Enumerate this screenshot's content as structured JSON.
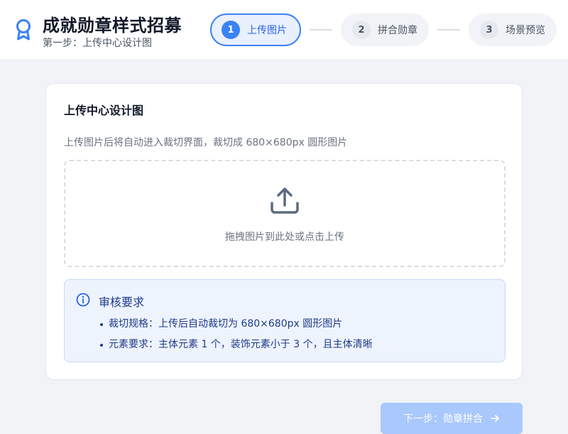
{
  "header": {
    "title": "成就勋章样式招募",
    "subtitle": "第一步：上传中心设计图",
    "brand_icon": "award-ribbon-icon",
    "accent_color": "#3b82f6"
  },
  "steps": [
    {
      "number": "1",
      "label": "上传图片",
      "active": true
    },
    {
      "number": "2",
      "label": "拼合勋章",
      "active": false
    },
    {
      "number": "3",
      "label": "场景预览",
      "active": false
    }
  ],
  "card": {
    "title": "上传中心设计图",
    "description": "上传图片后将自动进入裁切界面，裁切成 680×680px 圆形图片",
    "dropzone": {
      "icon": "upload-icon",
      "text": "拖拽图片到此处或点击上传"
    },
    "notice": {
      "icon": "info-icon",
      "title": "审核要求",
      "items": [
        "裁切规格：上传后自动裁切为 680×680px 圆形图片",
        "元素要求：主体元素 1 个，装饰元素小于 3 个，且主体清晰"
      ]
    }
  },
  "footer": {
    "next_label": "下一步：勋章拼合",
    "next_icon": "arrow-right-icon",
    "next_disabled": true
  }
}
